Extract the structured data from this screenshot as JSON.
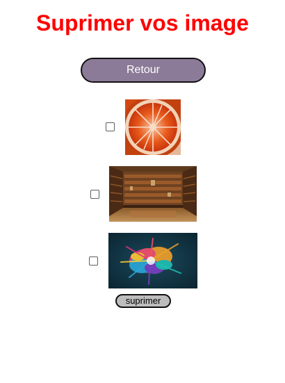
{
  "page": {
    "title": "Suprimer vos image",
    "title_color": "#ff0000"
  },
  "back_button": {
    "label": "Retour",
    "color": "#8c7b98"
  },
  "images": [
    {
      "subject": "blood orange slice",
      "checked": false
    },
    {
      "subject": "library with bookshelves",
      "checked": false
    },
    {
      "subject": "colorful powder explosion",
      "checked": false
    }
  ],
  "delete_button": {
    "label": "suprimer",
    "color": "#bdbdbd"
  }
}
